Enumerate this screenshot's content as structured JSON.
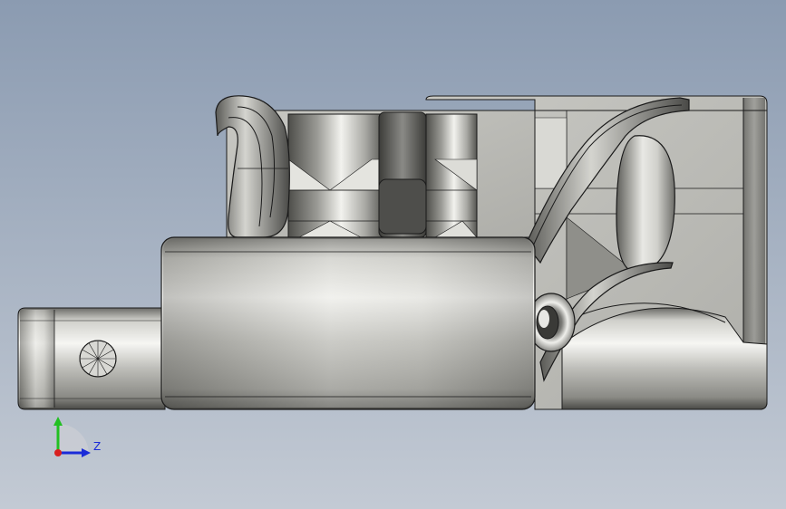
{
  "viewport": {
    "background_top": "#8b9bb1",
    "background_bottom": "#c3cad4"
  },
  "model": {
    "material_color": "#b9b9b4",
    "edge_color": "#1a1a1a",
    "highlight_color": "#f4f4f1",
    "shadow_color": "#5a5a56"
  },
  "triad": {
    "z_label": "Z",
    "y_axis_color": "#22c022",
    "z_axis_color": "#1a2bd8",
    "x_axis_color": "#d82020"
  }
}
